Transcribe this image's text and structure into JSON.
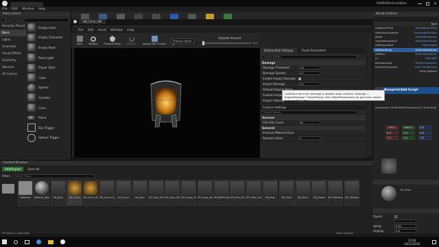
{
  "main_window": {
    "title": "Vd094Destructibles",
    "menu": [
      "File",
      "Edit",
      "Window",
      "Help"
    ]
  },
  "place_actors": {
    "tab": "Place Actors",
    "search_placeholder": "Search Classes",
    "categories": [
      "Recently Placed",
      "Basic",
      "Lights",
      "Cinematic",
      "Visual Effects",
      "Geometry",
      "Volumes",
      "All Classes"
    ],
    "selected_category": "Basic",
    "items": [
      "Empty Actor",
      "Empty Character",
      "Empty Pawn",
      "Point Light",
      "Player Start",
      "Cube",
      "Sphere",
      "Cylinder",
      "Cone",
      "Plane",
      "Box Trigger",
      "Sphere Trigger"
    ]
  },
  "world_outliner": {
    "tab": "World Outliner",
    "header_type": "Type",
    "rows": [
      {
        "label": "nosphericFog",
        "type": "AtmosphericFog"
      },
      {
        "label": "reflectionCapture",
        "type": "SphereReflection"
      },
      {
        "label": "Mesh",
        "type": "StaticMeshActor"
      },
      {
        "label": "mentationActor1",
        "type": "StaticMeshActor"
      },
      {
        "label": "ultPlayerStart",
        "type": "PlayerStart"
      },
      {
        "label": "allMeshActor",
        "type": "StaticMeshActor"
      },
      {
        "label": "allMesh",
        "type": "StaticMeshActor"
      },
      {
        "label": "(r)",
        "type": "SkyLight"
      },
      {
        "label": "blenderActor",
        "type": "TextRenderActor"
      },
      {
        "label": "PersonCharacter",
        "type": "Edit ThirdPerson"
      }
    ],
    "view_options": "View Options"
  },
  "right_details": {
    "add_component": "Blueprint/Add Script",
    "component": "Component (StaticMeshComponent) (Inherited)",
    "transform_values": [
      "-736.0",
      "1460.0",
      "0.0",
      "0.0",
      "0.0",
      "0.0",
      "1.0",
      "1.0",
      "1.0"
    ],
    "materials_title": "Materials",
    "element": "Element 0",
    "material_name": "M_Chair",
    "physics_title": "Physics",
    "physics_rows": [
      "Simulate Physics",
      "MassInKg",
      "Linear Damping",
      "Angular Damping"
    ],
    "linear_damping": "0.01",
    "angular_damping": "0.0"
  },
  "destructible_editor": {
    "title": "SM_Chair_DM",
    "menu": [
      "File",
      "Edit",
      "Asset",
      "Window",
      "Help"
    ],
    "toolbar": [
      {
        "label": "Save",
        "icon": "save-icon"
      },
      {
        "label": "Browse",
        "icon": "search-icon"
      },
      {
        "label": "Fracture Mesh",
        "icon": "fracture-icon"
      },
      {
        "label": "Refresh",
        "icon": "refresh-icon"
      },
      {
        "label": "Import FBX Chunks",
        "icon": "import-icon"
      }
    ],
    "preview_depth": "Preview Depth 0",
    "explode_amount_label": "Explode Amount",
    "explode_value": "0.1",
    "tabs": [
      "Destructible Settings",
      "Chunk Parameters"
    ],
    "search_placeholder": "Search Details",
    "damage_section": "Damage",
    "damage_rows": [
      {
        "label": "Damage Threshold",
        "value": "1.0"
      },
      {
        "label": "Damage Spread",
        "value": "0.1"
      },
      {
        "label": "Enable Impact Damage",
        "value": ""
      },
      {
        "label": "Impact Damage",
        "value": "0.1"
      },
      {
        "label": "Default Impact Dama",
        "value": ""
      },
      {
        "label": "Custom Impact Dama",
        "value": ""
      },
      {
        "label": "Impact Velocity",
        "value": "0.0"
      }
    ],
    "tooltip": "Controls how much damage is applied upon collision. Damage = ImpactDamage * ImpactForce. See: DepthParameters for per level control of ImpactDamage",
    "fracture_tab": "Fracture Settings",
    "fracture_search": "Search Details",
    "voronoi_section": "Voronoi",
    "cell_site_count_label": "Cell Site Count",
    "cell_site_count": "30",
    "general_section": "General",
    "fracture_material_label": "Fracture Material Desc",
    "random_seed_label": "Random Seed",
    "random_seed": "0"
  },
  "content_browser": {
    "tab": "Content Browser",
    "add_import": "Add/Import",
    "save_all": "Save All",
    "filters": "Filters",
    "search_placeholder": "Search Props",
    "tiles": [
      "Materials",
      "Material_Sphere",
      "SM_Bush",
      "SM_Chair",
      "SM_Chair_DM",
      "SM_Corner_Frame",
      "SM_Couch",
      "SM_Door",
      "SM_Door_Frame",
      "SM_Glass_Window",
      "SM_Lamp_Ceiling",
      "SM_Lamp_Wall",
      "SM_MatPreviewMesh_02",
      "SM_Pillar_Frame",
      "SM_Pillar_Frame300",
      "SM_Rock",
      "SM_Shelf",
      "SM_Stairs",
      "SM_Statue",
      "SM_TableRound",
      "SM_Window"
    ],
    "items_count": "23 items (1 selected)",
    "view_options": "View Options"
  },
  "taskbar": {
    "time": "13:26",
    "date": "14/12/2016"
  }
}
